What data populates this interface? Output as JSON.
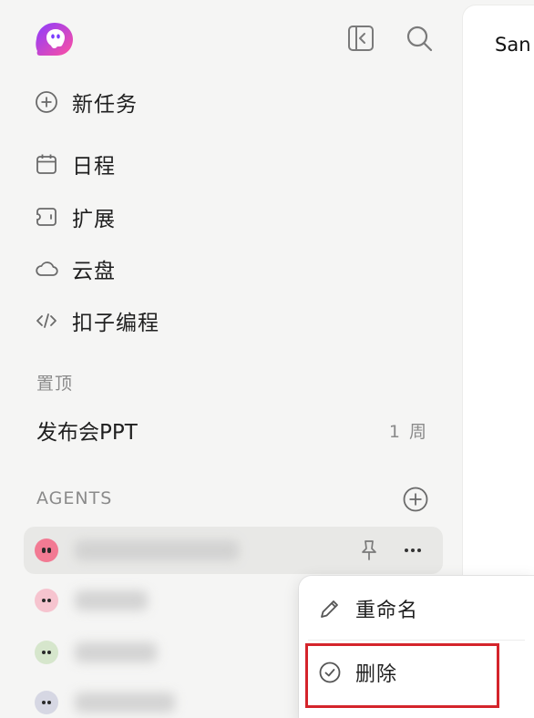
{
  "main": {
    "title": "San"
  },
  "nav": [
    {
      "label": "新任务",
      "icon": "plus-circle-icon"
    },
    {
      "label": "日程",
      "icon": "calendar-icon"
    },
    {
      "label": "扩展",
      "icon": "extension-icon"
    },
    {
      "label": "云盘",
      "icon": "cloud-icon"
    },
    {
      "label": "扣子编程",
      "icon": "code-icon"
    }
  ],
  "pinned": {
    "section_label": "置顶",
    "item": {
      "title": "发布会PPT",
      "time": "1 周"
    }
  },
  "agents": {
    "section_label": "AGENTS"
  },
  "context_menu": {
    "rename": "重命名",
    "delete": "删除"
  },
  "colors": {
    "sidebar_bg": "#f5f5f4",
    "active_row": "#e8e8e6",
    "highlight": "#d4242b",
    "logo_gradient": [
      "#8b3cff",
      "#ff4fa0"
    ]
  }
}
